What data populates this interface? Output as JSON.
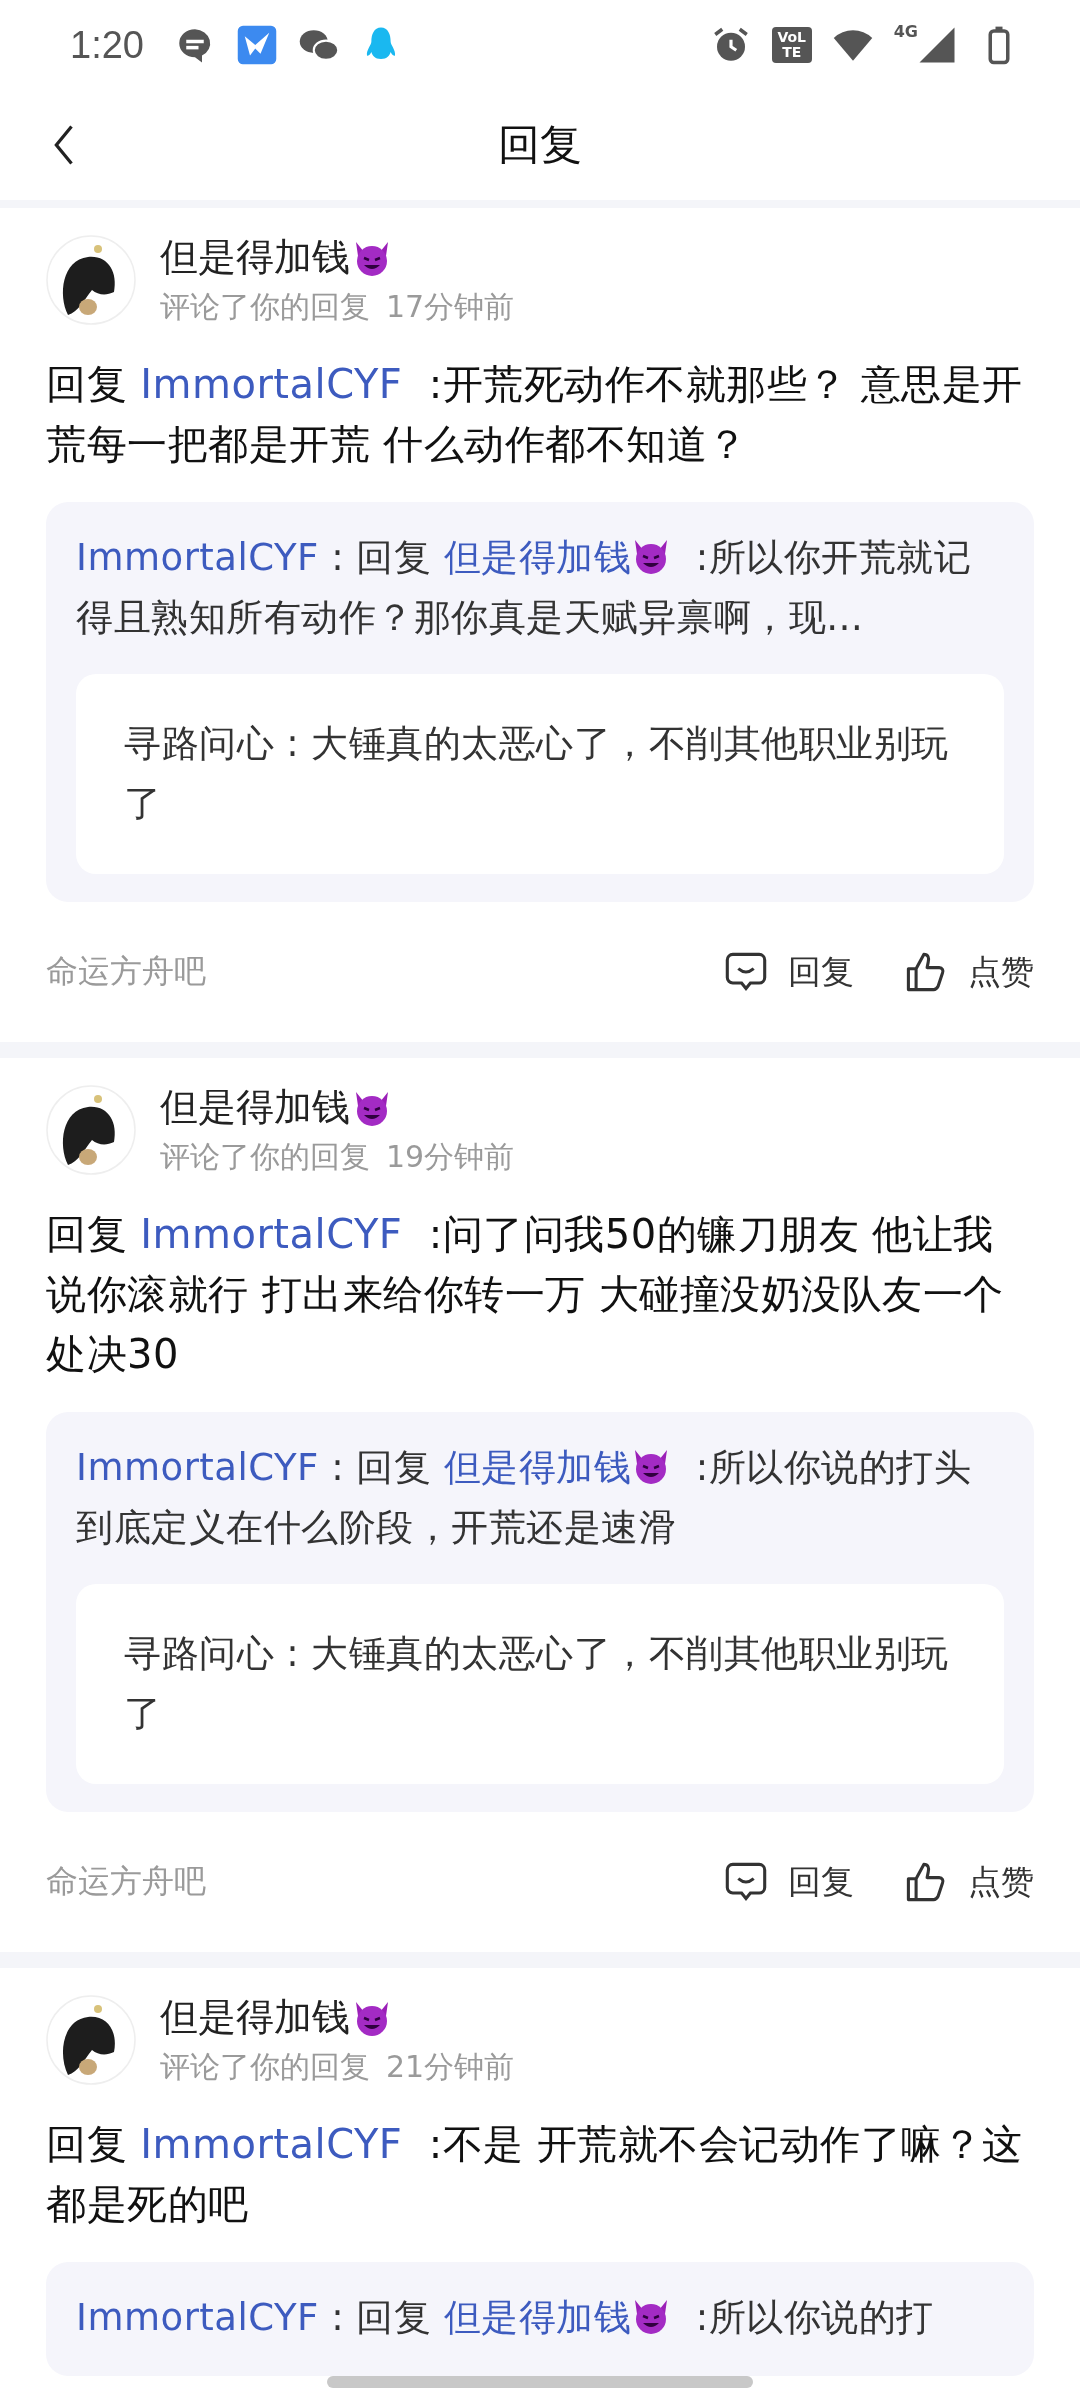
{
  "status_bar": {
    "time": "1:20",
    "volte": "VoLTE",
    "network": "4G"
  },
  "header": {
    "title": "回复"
  },
  "posts": [
    {
      "author": "但是得加钱",
      "action": "评论了你的回复",
      "time": "17分钟前",
      "reply_prefix": "回复",
      "reply_to": "ImmortalCYF",
      "text": ":开荒死动作不就那些？ 意思是开荒每一把都是开荒 什么动作都不知道？",
      "quote": {
        "author": "ImmortalCYF",
        "prefix": " : 回复 ",
        "target": "但是得加钱",
        "text": ":所以你开荒就记得且熟知所有动作？那你真是天赋异禀啊，现…"
      },
      "origin": "寻路问心 : 大锤真的太恶心了，不削其他职业别玩了",
      "forum": "命运方舟吧",
      "reply_label": "回复",
      "like_label": "点赞"
    },
    {
      "author": "但是得加钱",
      "action": "评论了你的回复",
      "time": "19分钟前",
      "reply_prefix": "回复",
      "reply_to": "ImmortalCYF",
      "text": ":问了问我50的镰刀朋友 他让我说你滚就行 打出来给你转一万 大碰撞没奶没队友一个处决30",
      "quote": {
        "author": "ImmortalCYF",
        "prefix": " : 回复 ",
        "target": "但是得加钱",
        "text": ":所以你说的打头到底定义在什么阶段，开荒还是速滑"
      },
      "origin": "寻路问心 : 大锤真的太恶心了，不削其他职业别玩了",
      "forum": "命运方舟吧",
      "reply_label": "回复",
      "like_label": "点赞"
    },
    {
      "author": "但是得加钱",
      "action": "评论了你的回复",
      "time": "21分钟前",
      "reply_prefix": "回复",
      "reply_to": "ImmortalCYF",
      "text": ":不是 开荒就不会记动作了嘛？这都是死的吧",
      "quote": {
        "author": "ImmortalCYF",
        "prefix": " : 回复 ",
        "target": "但是得加钱",
        "text": ":所以你说的打"
      }
    }
  ]
}
